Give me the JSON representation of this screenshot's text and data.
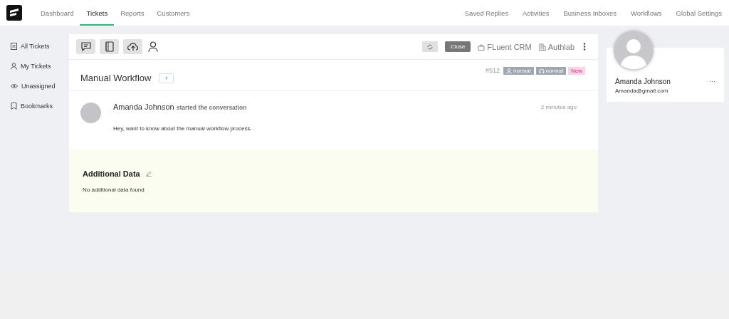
{
  "nav": {
    "left": [
      {
        "label": "Dashboard",
        "selected": false
      },
      {
        "label": "Tickets",
        "selected": true
      },
      {
        "label": "Reports",
        "selected": false
      },
      {
        "label": "Customers",
        "selected": false
      }
    ],
    "right": [
      {
        "label": "Saved Replies"
      },
      {
        "label": "Activities"
      },
      {
        "label": "Business Inboxes"
      },
      {
        "label": "Workflows"
      },
      {
        "label": "Global Settings"
      }
    ]
  },
  "sidebar": {
    "items": [
      {
        "label": "All Tickets",
        "kind": "list"
      },
      {
        "label": "My Tickets",
        "kind": "user"
      },
      {
        "label": "Unassigned",
        "kind": "eye"
      },
      {
        "label": "Bookmarks",
        "kind": "bookmark"
      }
    ]
  },
  "toolbar": {
    "close_button": "Close",
    "crm": "FLuent CRM",
    "product": "Authlab"
  },
  "ticket": {
    "title": "Manual Workflow",
    "add_button": "+",
    "number": "#512",
    "tags": [
      {
        "label": "normal",
        "kind": "user"
      },
      {
        "label": "normal",
        "kind": "headset"
      }
    ],
    "status": "New"
  },
  "conversation": {
    "author": "Amanda Johnson",
    "action": "started the conversation",
    "time": "2 minutes ago",
    "message": "Hey, want to know about the manual workflow process."
  },
  "additional_data": {
    "title": "Additional Data",
    "empty_text": "No additional data found"
  },
  "customer": {
    "name": "Amanda Johnson",
    "email": "Amanda@gmail.com",
    "menu": "···"
  }
}
